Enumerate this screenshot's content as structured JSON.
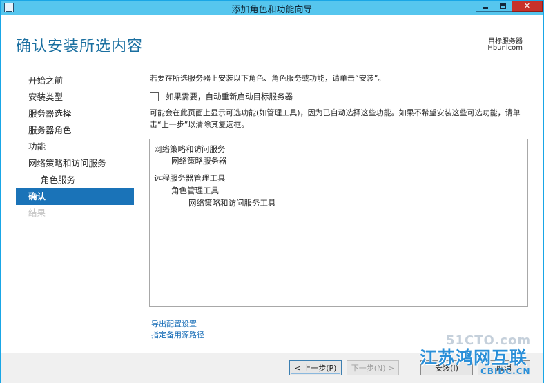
{
  "window": {
    "title": "添加角色和功能向导",
    "icon": "wizard-icon"
  },
  "header": {
    "title": "确认安装所选内容",
    "target_label": "目标服务器",
    "target_name": "Hbunicom"
  },
  "nav": {
    "items": [
      {
        "label": "开始之前",
        "state": "normal"
      },
      {
        "label": "安装类型",
        "state": "normal"
      },
      {
        "label": "服务器选择",
        "state": "normal"
      },
      {
        "label": "服务器角色",
        "state": "normal"
      },
      {
        "label": "功能",
        "state": "normal"
      },
      {
        "label": "网络策略和访问服务",
        "state": "normal"
      },
      {
        "label": "角色服务",
        "state": "sub"
      },
      {
        "label": "确认",
        "state": "active"
      },
      {
        "label": "结果",
        "state": "disabled"
      }
    ]
  },
  "content": {
    "intro": "若要在所选服务器上安装以下角色、角色服务或功能，请单击“安装”。",
    "restart_checkbox": {
      "label": "如果需要，自动重新启动目标服务器",
      "checked": false
    },
    "note": "可能会在此页面上显示可选功能(如管理工具)，因为已自动选择这些功能。如果不希望安装这些可选功能，请单击“上一步”以清除其复选框。",
    "selections": [
      {
        "label": "网络策略和访问服务",
        "level": 0
      },
      {
        "label": "网络策略服务器",
        "level": 1
      },
      {
        "label": "远程服务器管理工具",
        "level": 0
      },
      {
        "label": "角色管理工具",
        "level": 1
      },
      {
        "label": "网络策略和访问服务工具",
        "level": 2
      }
    ],
    "link_export": "导出配置设置",
    "link_source": "指定备用源路径"
  },
  "footer": {
    "prev_label": "< 上一步(P)",
    "next_label": "下一步(N) >",
    "install_label": "安装(I)",
    "cancel_label": "取消"
  },
  "watermark": {
    "site": "51CTO.com",
    "main": "江苏鸿网互联",
    "sub": "CBIDC.CN"
  }
}
